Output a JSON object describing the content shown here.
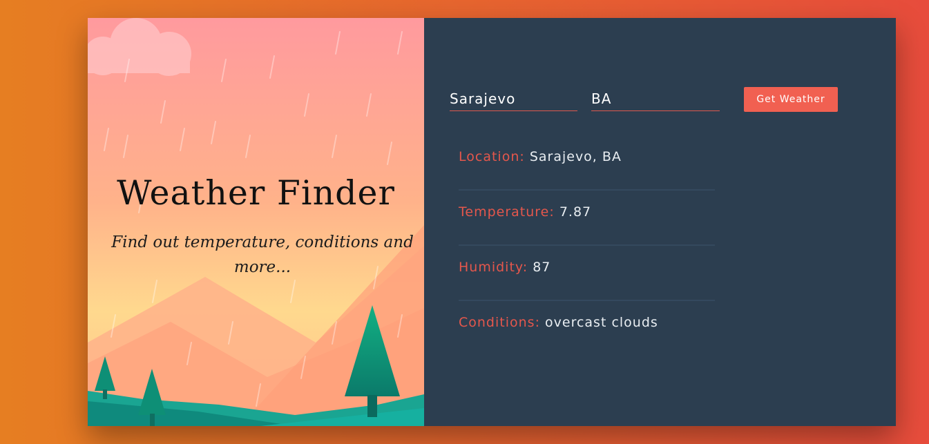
{
  "hero": {
    "title": "Weather Finder",
    "subtitle": "Find out temperature, conditions and more..."
  },
  "form": {
    "city_value": "Sarajevo",
    "country_value": "BA",
    "submit_label": "Get Weather"
  },
  "results": [
    {
      "label": "Location:",
      "value": "Sarajevo, BA"
    },
    {
      "label": "Temperature:",
      "value": "7.87"
    },
    {
      "label": "Humidity:",
      "value": "87"
    },
    {
      "label": "Conditions:",
      "value": "overcast clouds"
    }
  ],
  "colors": {
    "background_start": "#e67e22",
    "background_end": "#e74c3c",
    "panel": "#2c3e50",
    "accent": "#f16051",
    "label": "#e5574c"
  },
  "icons": [
    "cloud-icon",
    "tree-icon",
    "mountain-icon",
    "rain-icon"
  ]
}
